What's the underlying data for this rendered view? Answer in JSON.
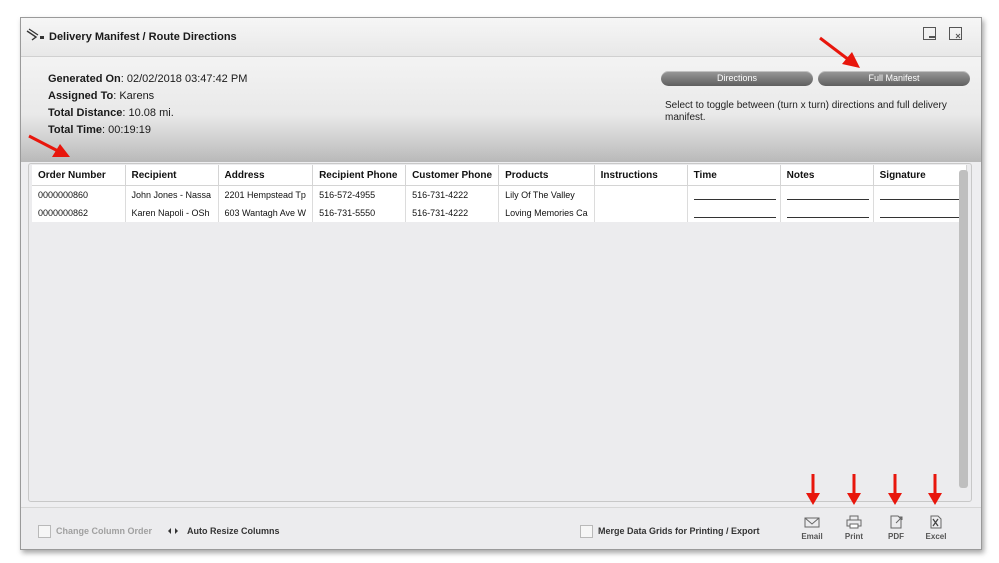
{
  "window": {
    "title": "Delivery Manifest / Route Directions",
    "icon": "route-directions-icon",
    "controls": [
      "minimize-icon",
      "close-icon"
    ]
  },
  "summary": {
    "generated_label": "Generated On",
    "generated_value": "02/02/2018  03:47:42 PM",
    "assigned_label": "Assigned To",
    "assigned_value": "Karens",
    "distance_label": "Total Distance",
    "distance_value": "10.08 mi.",
    "time_label": "Total Time",
    "time_value": "00:19:19"
  },
  "toggle": {
    "directions_label": "Directions",
    "manifest_label": "Full Manifest",
    "help_text": "Select to toggle between (turn x turn) directions and full delivery manifest."
  },
  "grid": {
    "columns": [
      "Order Number",
      "Recipient",
      "Address",
      "Recipient Phone",
      "Customer Phone",
      "Products",
      "Instructions",
      "Time",
      "Notes",
      "Signature"
    ],
    "rows": [
      {
        "order": "0000000860",
        "recipient": "John Jones  - Nassa",
        "address": "2201 Hempstead Tp",
        "recipient_phone": "516-572-4955",
        "customer_phone": "516-731-4222",
        "products": "Lily Of The Valley",
        "instructions": ""
      },
      {
        "order": "0000000862",
        "recipient": "Karen Napoli  - OSh",
        "address": "603 Wantagh Ave W",
        "recipient_phone": "516-731-5550",
        "customer_phone": "516-731-4222",
        "products": "Loving Memories Ca",
        "instructions": ""
      }
    ]
  },
  "footer": {
    "change_column_order": "Change Column Order",
    "auto_resize": "Auto Resize Columns",
    "merge_label": "Merge Data Grids for Printing / Export",
    "email_label": "Email",
    "print_label": "Print",
    "pdf_label": "PDF",
    "excel_label": "Excel"
  },
  "annotations": {
    "arrow_color": "#e8160c"
  },
  "colors": {
    "toggle_button": "#6f6f6f",
    "window_bg": "#eeeef0"
  }
}
